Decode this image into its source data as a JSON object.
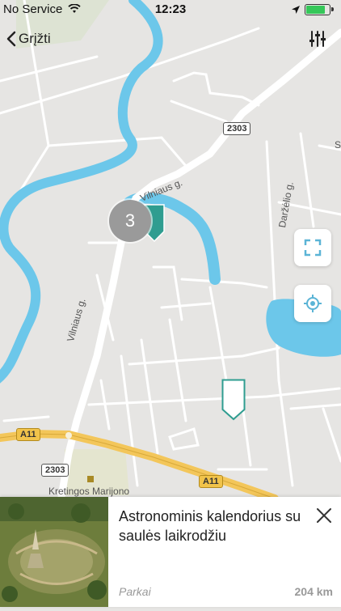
{
  "status_bar": {
    "carrier": "No Service",
    "time": "12:23"
  },
  "nav": {
    "back_label": "Grįžti"
  },
  "map": {
    "cluster_count": "3",
    "street_labels": [
      "Vilniaus g.",
      "Vilniaus g.",
      "Daržėlio g.",
      "S",
      "Kretingos Marijono"
    ],
    "road_shields": [
      "2303",
      "2303",
      "A11",
      "A11"
    ]
  },
  "card": {
    "title": "Astronominis kalendorius su saulės laikrodžiu",
    "category": "Parkai",
    "distance": "204 km"
  },
  "colors": {
    "water": "#6cc7ea",
    "accent": "#2f9d90",
    "main_road": "#f3c65a",
    "map_bg": "#e6e5e3"
  }
}
